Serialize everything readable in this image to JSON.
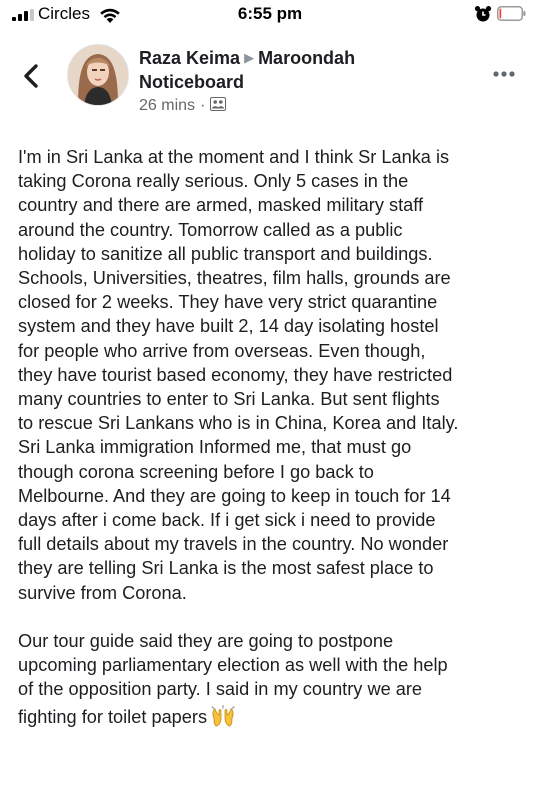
{
  "status_bar": {
    "carrier": "Circles",
    "time": "6:55 pm",
    "signal_bars_active": 3,
    "battery_level": 0.08
  },
  "header": {
    "author": "Raza Keima",
    "group_line_1": "Maroondah",
    "group_line_2": "Noticeboard",
    "time_ago": "26 mins",
    "separator": "·",
    "arrow_glyph": "▶"
  },
  "icons": {
    "back": "back-chevron-icon",
    "more": "more-dots-icon",
    "group": "group-privacy-icon",
    "emoji": "raised-hands-icon"
  },
  "post": {
    "lines_p1": [
      "I'm in Sri Lanka at the moment and I think Sr Lanka is",
      "taking Corona really serious. Only 5 cases in the",
      "country and there are armed, masked military staff",
      "around the country. Tomorrow called as a public",
      "holiday to sanitize all public transport and buildings.",
      "Schools, Universities, theatres, film halls, grounds are",
      "closed for 2 weeks. They have very strict quarantine",
      "system and they have built 2, 14 day isolating hostel",
      "for people who arrive from overseas. Even though,",
      "they have tourist based economy, they have restricted",
      "many countries to enter to Sri Lanka. But sent flights",
      "to rescue Sri Lankans who is in China, Korea and Italy.",
      "Sri Lanka immigration Informed me, that must go",
      "though corona screening before I go back to",
      "Melbourne. And they are going to keep in touch for 14",
      "days after i come back. If i get sick i need to provide",
      "full details about my travels in the country. No wonder",
      "they are telling Sri Lanka is the most safest place to",
      "survive from Corona."
    ],
    "lines_p2": [
      "Our tour guide said they are going to postpone",
      "upcoming parliamentary election as well with the help",
      "of the opposition party. I said in my country we are"
    ],
    "last_line": "fighting for toilet papers"
  }
}
